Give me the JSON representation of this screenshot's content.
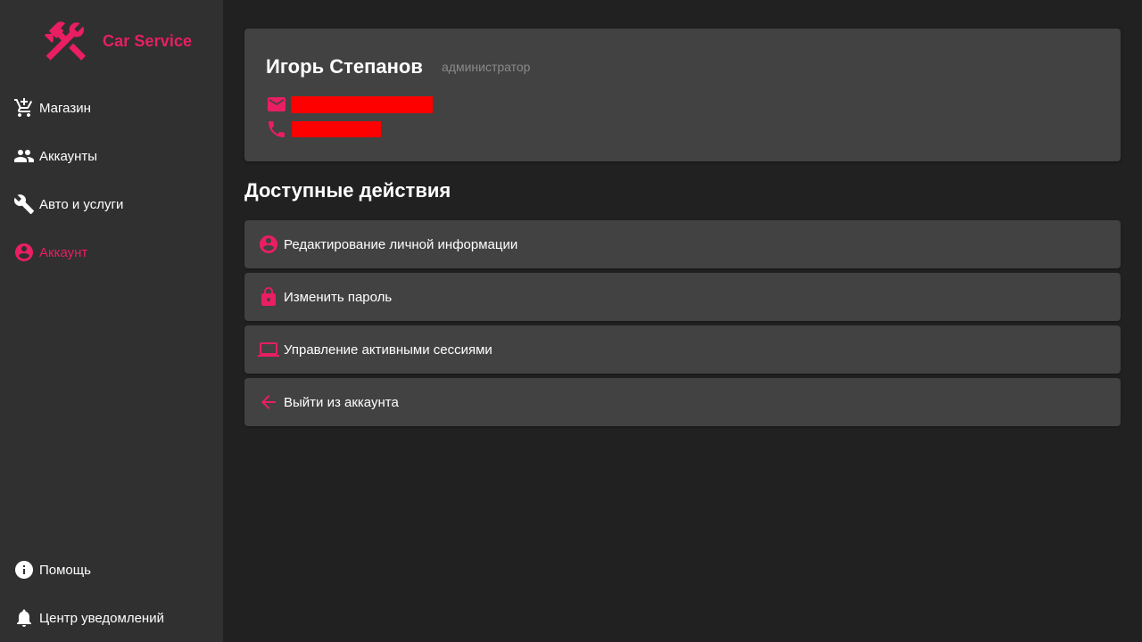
{
  "colors": {
    "accent": "#e91e63",
    "sidebar_bg": "#303030",
    "main_bg": "#212121",
    "card_bg": "#424242",
    "redaction": "#ff0000",
    "muted_text": "#8a8a8a"
  },
  "brand": {
    "name": "Car Service",
    "logo_icon": "tools-icon"
  },
  "sidebar": {
    "items": [
      {
        "label": "Магазин",
        "icon": "cart-icon",
        "active": false
      },
      {
        "label": "Аккаунты",
        "icon": "people-icon",
        "active": false
      },
      {
        "label": "Авто и услуги",
        "icon": "wrench-icon",
        "active": false
      },
      {
        "label": "Аккаунт",
        "icon": "account-circle-icon",
        "active": true
      }
    ],
    "bottom_items": [
      {
        "label": "Помощь",
        "icon": "info-icon"
      },
      {
        "label": "Центр уведомлений",
        "icon": "bell-icon"
      }
    ]
  },
  "profile": {
    "name": "Игорь Степанов",
    "role": "администратор",
    "email_icon": "email-icon",
    "phone_icon": "phone-icon"
  },
  "actions": {
    "title": "Доступные действия",
    "items": [
      {
        "label": "Редактирование личной информации",
        "icon": "account-circle-icon"
      },
      {
        "label": "Изменить пароль",
        "icon": "lock-icon"
      },
      {
        "label": "Управление активными сессиями",
        "icon": "laptop-icon"
      },
      {
        "label": "Выйти из аккаунта",
        "icon": "arrow-left-icon"
      }
    ]
  }
}
